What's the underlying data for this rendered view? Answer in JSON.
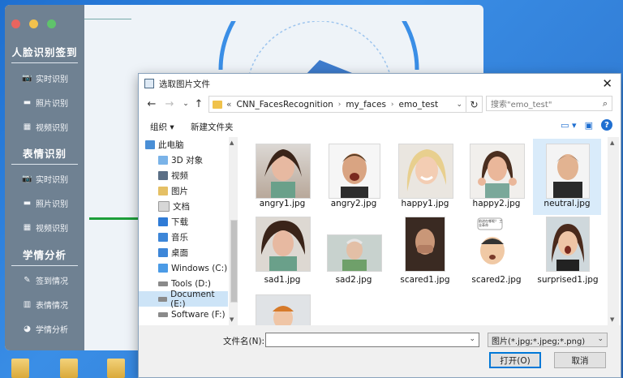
{
  "app": {
    "sections": [
      {
        "title": "人脸识别签到",
        "items": [
          {
            "icon": "camera-icon",
            "label": "实时识别"
          },
          {
            "icon": "folder-icon",
            "label": "照片识别"
          },
          {
            "icon": "film-icon",
            "label": "视频识别"
          }
        ]
      },
      {
        "title": "表情识别",
        "items": [
          {
            "icon": "camera-icon",
            "label": "实时识别"
          },
          {
            "icon": "folder-icon",
            "label": "照片识别"
          },
          {
            "icon": "film-icon",
            "label": "视频识别"
          }
        ]
      },
      {
        "title": "学情分析",
        "items": [
          {
            "icon": "edit-icon",
            "label": "签到情况"
          },
          {
            "icon": "bar-chart-icon",
            "label": "表情情况"
          },
          {
            "icon": "pie-chart-icon",
            "label": "学情分析"
          }
        ]
      }
    ],
    "traffic_lights": [
      "#e8655f",
      "#f1c14d",
      "#5fc36b"
    ]
  },
  "dialog": {
    "title": "选取图片文件",
    "breadcrumb": [
      "CNN_FacesRecognition",
      "my_faces",
      "emo_test"
    ],
    "breadcrumb_prefix": "«",
    "search_placeholder": "搜索\"emo_test\"",
    "toolbar": {
      "organize": "组织 ▾",
      "new_folder": "新建文件夹"
    },
    "nav_items": [
      {
        "label": "此电脑",
        "icon": "computer-icon",
        "selected": false
      },
      {
        "label": "3D 对象",
        "icon": "3d-objects-icon",
        "selected": false
      },
      {
        "label": "视频",
        "icon": "videos-icon",
        "selected": false
      },
      {
        "label": "图片",
        "icon": "pictures-icon",
        "selected": false
      },
      {
        "label": "文档",
        "icon": "documents-icon",
        "selected": false
      },
      {
        "label": "下载",
        "icon": "downloads-icon",
        "selected": false
      },
      {
        "label": "音乐",
        "icon": "music-icon",
        "selected": false
      },
      {
        "label": "桌面",
        "icon": "desktop-icon",
        "selected": false
      },
      {
        "label": "Windows (C:)",
        "icon": "drive-icon",
        "selected": false
      },
      {
        "label": "Tools (D:)",
        "icon": "drive-icon",
        "selected": false
      },
      {
        "label": "Document (E:)",
        "icon": "drive-icon",
        "selected": true
      },
      {
        "label": "Software (F:)",
        "icon": "drive-icon",
        "selected": false
      }
    ],
    "files": [
      {
        "name": "angry1.jpg",
        "selected": false
      },
      {
        "name": "angry2.jpg",
        "selected": false
      },
      {
        "name": "happy1.jpg",
        "selected": false
      },
      {
        "name": "happy2.jpg",
        "selected": false
      },
      {
        "name": "neutral.jpg",
        "selected": true
      },
      {
        "name": "sad1.jpg",
        "selected": false
      },
      {
        "name": "sad2.jpg",
        "selected": false
      },
      {
        "name": "scared1.jpg",
        "selected": false
      },
      {
        "name": "scared2.jpg",
        "selected": false
      },
      {
        "name": "surprised1.jpg",
        "selected": false
      },
      {
        "name": "",
        "selected": false
      }
    ],
    "filename_label": "文件名(N):",
    "filename_value": "",
    "filter_value": "图片(*.jpg;*.jpeg;*.png)",
    "open_button": "打开(O)",
    "cancel_button": "取消",
    "scared2_caption": "前进在哪呢？ 工业革命"
  },
  "colors": {
    "accent": "#0078d7",
    "sidebar_bg": "#6f8192",
    "selection": "#cde4f7"
  }
}
